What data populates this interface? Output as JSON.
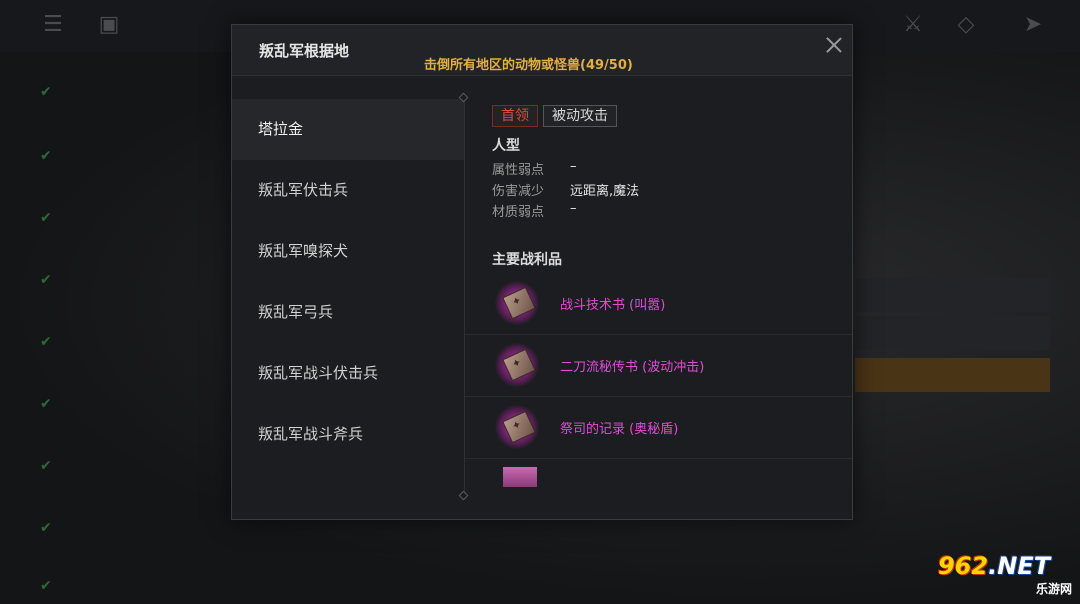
{
  "modal": {
    "title": "叛乱军根据地",
    "quest_progress": "击倒所有地区的动物或怪兽(49/50)"
  },
  "enemy_list": [
    {
      "label": "塔拉金",
      "selected": true
    },
    {
      "label": "叛乱军伏击兵",
      "selected": false
    },
    {
      "label": "叛乱军嗅探犬",
      "selected": false
    },
    {
      "label": "叛乱军弓兵",
      "selected": false
    },
    {
      "label": "叛乱军战斗伏击兵",
      "selected": false
    },
    {
      "label": "叛乱军战斗斧兵",
      "selected": false
    }
  ],
  "detail": {
    "tags": [
      {
        "label": "首领",
        "kind": "boss"
      },
      {
        "label": "被动攻击",
        "kind": "normal"
      }
    ],
    "type": "人型",
    "attributes": [
      {
        "key": "属性弱点",
        "value": "–"
      },
      {
        "key": "伤害减少",
        "value": "远距离,魔法"
      },
      {
        "key": "材质弱点",
        "value": "–"
      }
    ],
    "loot_title": "主要战利品",
    "loot": [
      {
        "name": "战斗技术书 (叫嚣)",
        "icon": "book-icon"
      },
      {
        "name": "二刀流秘传书 (波动冲击)",
        "icon": "book-icon"
      },
      {
        "name": "祭司的记录 (奥秘盾)",
        "icon": "book-icon"
      }
    ]
  },
  "colors": {
    "quest_text": "#e0b040",
    "boss_tag": "#e04a3c",
    "loot_name": "#e34ad8",
    "loot_glow": "#e63cdc"
  },
  "watermark": {
    "logo_number": "962",
    "logo_suffix": ".NET",
    "subtitle": "乐游网"
  }
}
